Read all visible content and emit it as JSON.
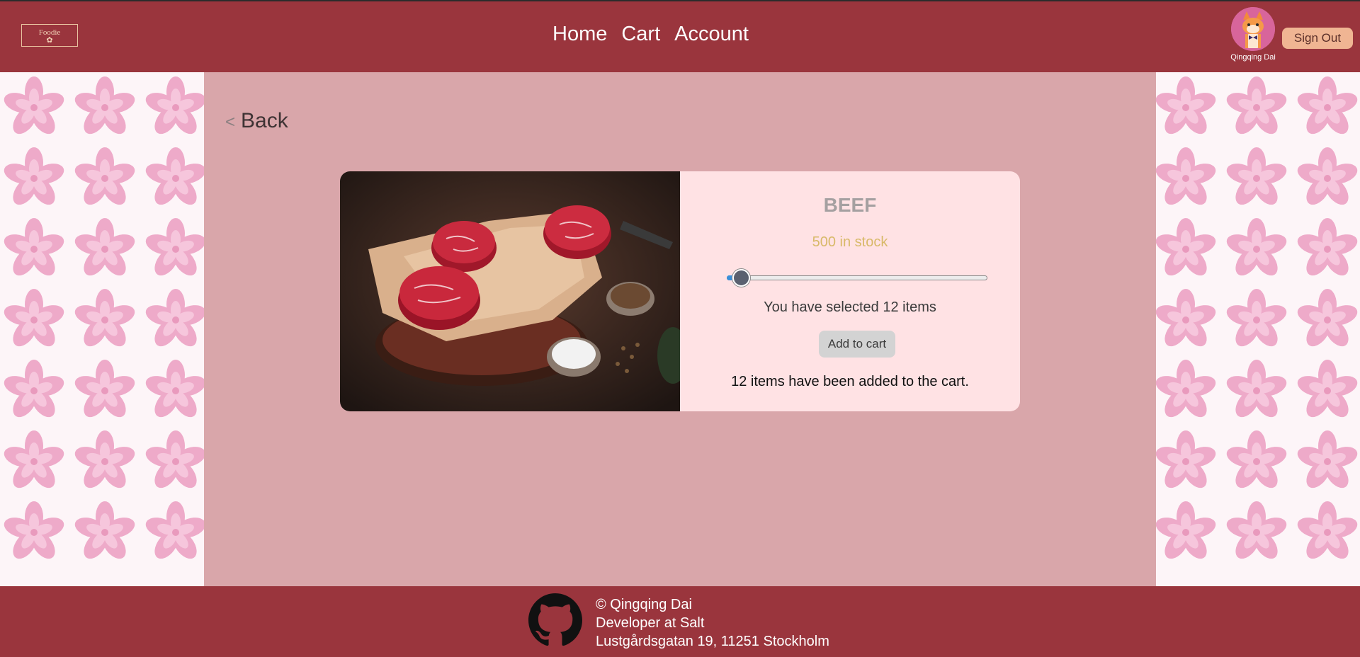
{
  "header": {
    "logo_text": "Foodie",
    "nav": [
      "Home",
      "Cart",
      "Account"
    ],
    "user_name": "Qingqing Dai",
    "sign_out_label": "Sign Out"
  },
  "main": {
    "back_label": "Back",
    "product": {
      "name": "BEEF",
      "stock_text": "500 in stock",
      "slider": {
        "value": 12,
        "min": 0,
        "max": 500
      },
      "selected_text": "You have selected 12 items",
      "add_button_label": "Add to cart",
      "added_message": "12 items have been added to the cart."
    }
  },
  "footer": {
    "line1": "© Qingqing Dai",
    "line2": "Developer at Salt",
    "line3": "Lustgårdsgatan 19, 11251 Stockholm"
  },
  "colors": {
    "brand": "#9a353d",
    "panel": "#d9a6aa",
    "card": "#ffe2e4",
    "stock": "#d8b968",
    "signout": "#f0b593"
  },
  "icons": {
    "logo": "foodie-logo-icon",
    "avatar": "cat-avatar-icon",
    "github": "github-icon"
  }
}
